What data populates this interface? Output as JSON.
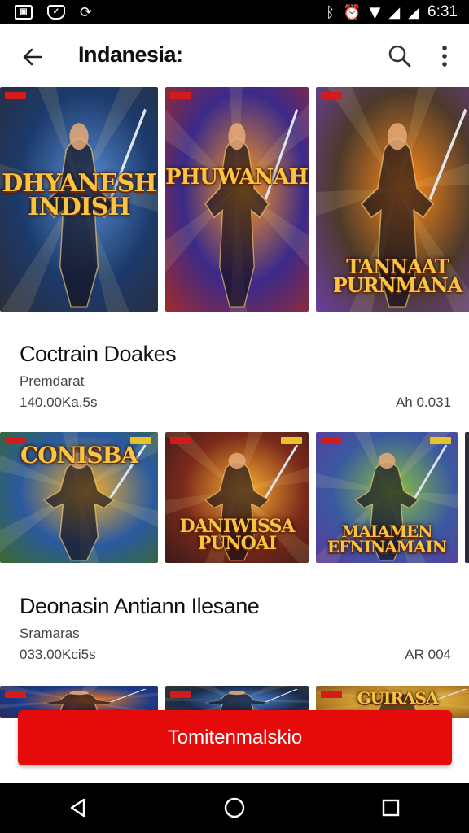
{
  "status_bar": {
    "time": "6:31",
    "left_icons": [
      "image-icon",
      "shield-icon",
      "sync-icon"
    ],
    "right_icons": [
      "bluetooth-icon",
      "alarm-icon",
      "wifi-icon",
      "signal-icon",
      "signal-icon"
    ]
  },
  "app_bar": {
    "title": "Indanesia:",
    "back_icon": "back-arrow-icon",
    "search_icon": "search-icon",
    "more_icon": "more-vert-icon"
  },
  "rows": [
    {
      "cards": [
        {
          "logo": "DHYANESH\nINDISH",
          "palette": [
            "#1c3a6b",
            "#5a8fd6",
            "#2a2d3a"
          ]
        },
        {
          "logo": "PHUWANAHN",
          "palette": [
            "#3b2a8a",
            "#ff9a1a",
            "#9f2b2b"
          ]
        },
        {
          "logo": "TANNAAT\nPURNMANA",
          "palette": [
            "#4d3a2a",
            "#ff8a1a",
            "#6a3fa0"
          ]
        }
      ]
    },
    {
      "cards": [
        {
          "logo": "CONISBA",
          "palette": [
            "#2a5aa0",
            "#f6b02a",
            "#3a6a2a"
          ]
        },
        {
          "logo": "DANIWISSA\nPUNOAI",
          "palette": [
            "#7a2a1a",
            "#ffb030",
            "#3a1a1a"
          ]
        },
        {
          "logo": "MAIAMEN\nEFNINAMAIN",
          "palette": [
            "#3a5aa0",
            "#8ac040",
            "#5a3aa0"
          ]
        }
      ]
    },
    {
      "cards": [
        {
          "logo": "",
          "palette": [
            "#1a3a8a",
            "#ff7a1a",
            "#2a2a5a"
          ]
        },
        {
          "logo": "",
          "palette": [
            "#1a2a4a",
            "#4a8ae0",
            "#3a3a2a"
          ]
        },
        {
          "logo": "GUIRASA",
          "palette": [
            "#c08a2a",
            "#f7d04a",
            "#7a4a1a"
          ]
        }
      ]
    }
  ],
  "sections": [
    {
      "title": "Coctrain Doakes",
      "subtitle": "Premdarat",
      "meta_left": "140.00Ka.5s",
      "meta_right": "Ah 0.031"
    },
    {
      "title": "Deonasin Antiann Ilesane",
      "subtitle": "Sramaras",
      "meta_left": "033.00Kci5s",
      "meta_right": "AR 004"
    }
  ],
  "cta": {
    "label": "Tomitenmalskio",
    "color": "#e60b0b"
  },
  "nav_bar": {
    "icons": [
      "nav-back-icon",
      "nav-home-icon",
      "nav-recents-icon"
    ]
  }
}
